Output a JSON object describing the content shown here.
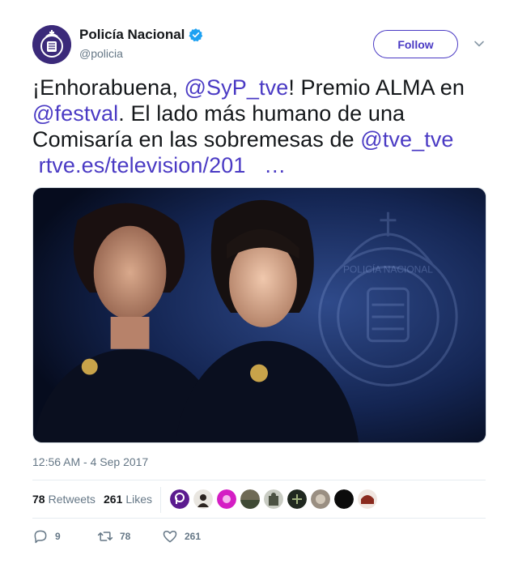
{
  "author": {
    "display_name": "Policía Nacional",
    "handle": "@policia",
    "verified": true,
    "avatar_icon": "police-badge-icon"
  },
  "follow_label": "Follow",
  "tweet": {
    "text_parts": [
      {
        "text": "¡Enhorabuena, "
      },
      {
        "text": "@SyP_tve",
        "type": "mention"
      },
      {
        "text": "! Premio ALMA en"
      },
      {
        "text": "@festval",
        "type": "mention"
      },
      {
        "text": ". El lado más humano de una"
      },
      {
        "text": "Comisaría en las sobremesas de "
      },
      {
        "text": "@tve_tve",
        "type": "mention"
      },
      {
        "text": "rtve.es/television/201",
        "type": "link"
      },
      {
        "text": "…",
        "type": "link"
      }
    ]
  },
  "media": {
    "badge_text": "POLICÍA NACIONAL"
  },
  "timestamp": "12:56 AM - 4 Sep 2017",
  "stats": {
    "retweets_count": "78",
    "retweets_label": "Retweets",
    "likes_count": "261",
    "likes_label": "Likes"
  },
  "actions": {
    "replies": "9",
    "retweets": "78",
    "likes": "261"
  },
  "colors": {
    "accent": "#4a3ac4",
    "text": "#14171a",
    "muted": "#657786",
    "verified": "#1da1f2"
  }
}
